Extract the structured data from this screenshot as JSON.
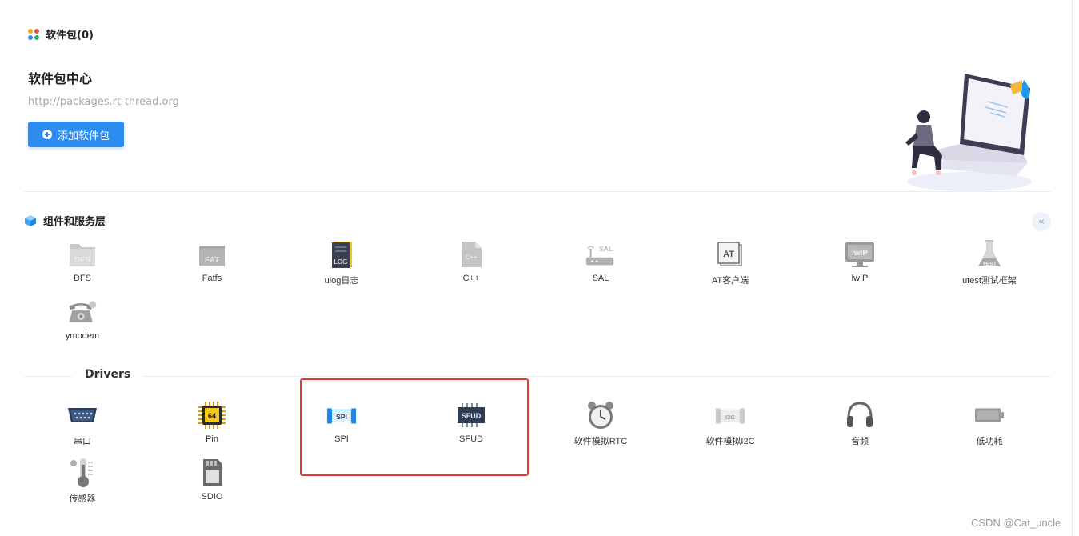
{
  "packages": {
    "title": "软件包(0)"
  },
  "center": {
    "title": "软件包中心",
    "url": "http://packages.rt-thread.org",
    "add_label": "添加软件包"
  },
  "components": {
    "title": "组件和服务层",
    "collapse": "«",
    "items": [
      {
        "label": "DFS",
        "icon": "DFS",
        "icon_name": "dfs-folder-icon"
      },
      {
        "label": "Fatfs",
        "icon": "FAT",
        "icon_name": "fat-folder-icon"
      },
      {
        "label": "ulog日志",
        "icon": "LOG",
        "icon_name": "log-book-icon"
      },
      {
        "label": "C++",
        "icon": "C++",
        "icon_name": "cpp-file-icon"
      },
      {
        "label": "SAL",
        "icon": "SAL",
        "icon_name": "router-icon"
      },
      {
        "label": "AT客户端",
        "icon": "AT",
        "icon_name": "at-icon"
      },
      {
        "label": "lwIP",
        "icon": "lwIP",
        "icon_name": "monitor-icon"
      },
      {
        "label": "utest测试框架",
        "icon": "TEST",
        "icon_name": "flask-icon"
      },
      {
        "label": "ymodem",
        "icon": "",
        "icon_name": "telephone-icon"
      }
    ]
  },
  "drivers": {
    "title": "Drivers",
    "items": [
      {
        "label": "串口",
        "icon": "",
        "icon_name": "serial-port-icon"
      },
      {
        "label": "Pin",
        "icon": "64",
        "icon_name": "chip-icon"
      },
      {
        "label": "SPI",
        "icon": "SPI",
        "icon_name": "spi-module-icon"
      },
      {
        "label": "SFUD",
        "icon": "SFUD",
        "icon_name": "flash-chip-icon"
      },
      {
        "label": "软件模拟RTC",
        "icon": "",
        "icon_name": "alarm-clock-icon"
      },
      {
        "label": "软件模拟I2C",
        "icon": "I2C",
        "icon_name": "i2c-module-icon"
      },
      {
        "label": "音频",
        "icon": "",
        "icon_name": "headphones-icon"
      },
      {
        "label": "低功耗",
        "icon": "",
        "icon_name": "battery-icon"
      },
      {
        "label": "传感器",
        "icon": "",
        "icon_name": "thermometer-icon"
      },
      {
        "label": "SDIO",
        "icon": "",
        "icon_name": "sd-card-icon"
      }
    ]
  },
  "watermark": "CSDN @Cat_uncle"
}
